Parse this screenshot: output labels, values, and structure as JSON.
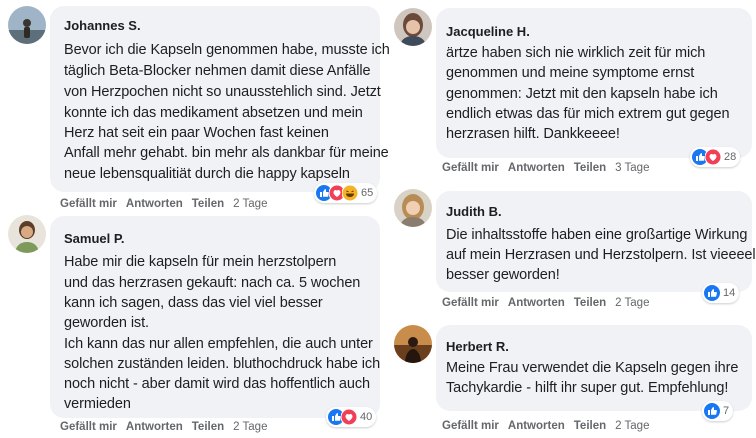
{
  "actions": {
    "like": "Gefällt mir",
    "reply": "Antworten",
    "share": "Teilen"
  },
  "colors": {
    "bubble": "#f0f2f5",
    "like": "#1877f2",
    "love": "#f33e58",
    "haha": "#f7b125"
  },
  "comments": [
    {
      "name": "Johannes S.",
      "lines": [
        "Bevor ich die Kapseln genommen habe, musste ich",
        "täglich Beta-Blocker nehmen damit diese Anfälle",
        "von Herzpochen nicht so unausstehlich sind. Jetzt",
        "konnte ich das medikament absetzen und mein",
        "Herz hat seit ein paar Wochen fast keinen",
        "Anfall mehr gehabt. bin mehr als dankbar für meine",
        "neue lebensqualitiät durch die happy kapseln"
      ],
      "time": "2 Tage",
      "reactions": 65,
      "reaction_icons": [
        "like-icon",
        "love-icon",
        "haha-icon"
      ]
    },
    {
      "name": "Samuel P.",
      "lines": [
        "Habe mir die kapseln für mein herzstolpern",
        "und das herzrasen gekauft: nach ca. 5 wochen",
        "kann ich sagen, dass das viel viel besser",
        "geworden ist.",
        "Ich kann das nur allen empfehlen, die auch unter",
        "solchen zuständen leiden. bluthochdruck habe ich",
        "noch nicht - aber damit wird das hoffentlich auch",
        "vermieden"
      ],
      "time": "2 Tage",
      "reactions": 40,
      "reaction_icons": [
        "like-icon",
        "love-icon"
      ]
    },
    {
      "name": "Jacqueline H.",
      "lines": [
        "ärtze haben sich nie wirklich zeit für mich",
        "genommen und meine symptome ernst",
        "genommen: Jetzt mit den kapseln habe ich",
        "endlich etwas das für mich extrem gut gegen",
        "herzrasen hilft. Dankkeeee!"
      ],
      "time": "3 Tage",
      "reactions": 28,
      "reaction_icons": [
        "like-icon",
        "love-icon"
      ]
    },
    {
      "name": "Judith B.",
      "lines": [
        "Die inhaltsstoffe haben eine großartige Wirkung",
        "auf mein Herzrasen und Herzstolpern. Ist vieeeel",
        "besser geworden!"
      ],
      "time": "2 Tage",
      "reactions": 14,
      "reaction_icons": [
        "like-icon"
      ]
    },
    {
      "name": "Herbert R.",
      "lines": [
        "Meine Frau verwendet die Kapseln gegen ihre",
        "Tachykardie - hilft ihr super gut. Empfehlung!"
      ],
      "time": "2 Tage",
      "reactions": 7,
      "reaction_icons": [
        "like-icon"
      ]
    }
  ]
}
